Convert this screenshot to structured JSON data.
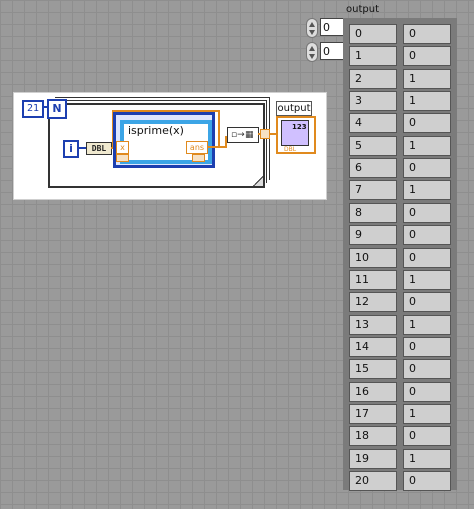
{
  "diagram": {
    "n_const": "21",
    "n_terminal": "N",
    "i_terminal": "i",
    "dbl_label": "DBL",
    "mathscript_text": "isprime(x)",
    "x_label": "x",
    "ans_label": "ans",
    "output_label": "output",
    "output_type": "123",
    "output_dbl": "DBL"
  },
  "indices": [
    "0",
    "0"
  ],
  "array": {
    "label": "output",
    "rows": [
      [
        "0",
        "0"
      ],
      [
        "1",
        "0"
      ],
      [
        "2",
        "1"
      ],
      [
        "3",
        "1"
      ],
      [
        "4",
        "0"
      ],
      [
        "5",
        "1"
      ],
      [
        "6",
        "0"
      ],
      [
        "7",
        "1"
      ],
      [
        "8",
        "0"
      ],
      [
        "9",
        "0"
      ],
      [
        "10",
        "0"
      ],
      [
        "11",
        "1"
      ],
      [
        "12",
        "0"
      ],
      [
        "13",
        "1"
      ],
      [
        "14",
        "0"
      ],
      [
        "15",
        "0"
      ],
      [
        "16",
        "0"
      ],
      [
        "17",
        "1"
      ],
      [
        "18",
        "0"
      ],
      [
        "19",
        "1"
      ],
      [
        "20",
        "0"
      ]
    ]
  }
}
